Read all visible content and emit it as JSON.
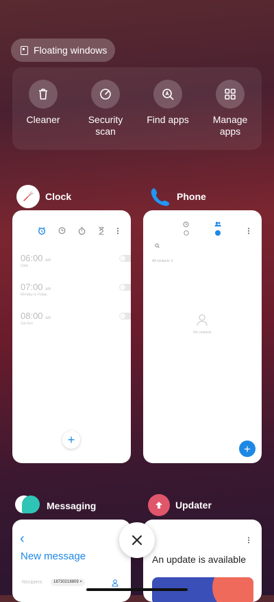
{
  "floating_windows": {
    "label": "Floating windows"
  },
  "quick_actions": [
    {
      "label": "Cleaner",
      "icon": "trash-icon"
    },
    {
      "label": "Security scan",
      "icon": "gauge-icon"
    },
    {
      "label": "Find apps",
      "icon": "app-search-icon"
    },
    {
      "label": "Manage apps",
      "icon": "grid-icon"
    }
  ],
  "cards": {
    "clock": {
      "title": "Clock",
      "alarms": [
        {
          "time": "06:00",
          "ampm": "am",
          "repeat": "Daily"
        },
        {
          "time": "07:00",
          "ampm": "am",
          "repeat": "Monday to Friday"
        },
        {
          "time": "08:00",
          "ampm": "am",
          "repeat": "Sat-Sun"
        }
      ],
      "add_label": "+"
    },
    "phone": {
      "title": "Phone",
      "contacts_filter": "All contacts",
      "empty_text": "No contacts",
      "add_label": "+"
    },
    "messaging": {
      "title": "Messaging",
      "back_label": "‹",
      "heading": "New message",
      "recipient_label": "Recipient",
      "recipient_number": "18730218809"
    },
    "updater": {
      "title": "Updater",
      "headline": "An update is available"
    }
  },
  "colors": {
    "accent_blue": "#1e88e5",
    "updater_red": "#e0566a"
  }
}
